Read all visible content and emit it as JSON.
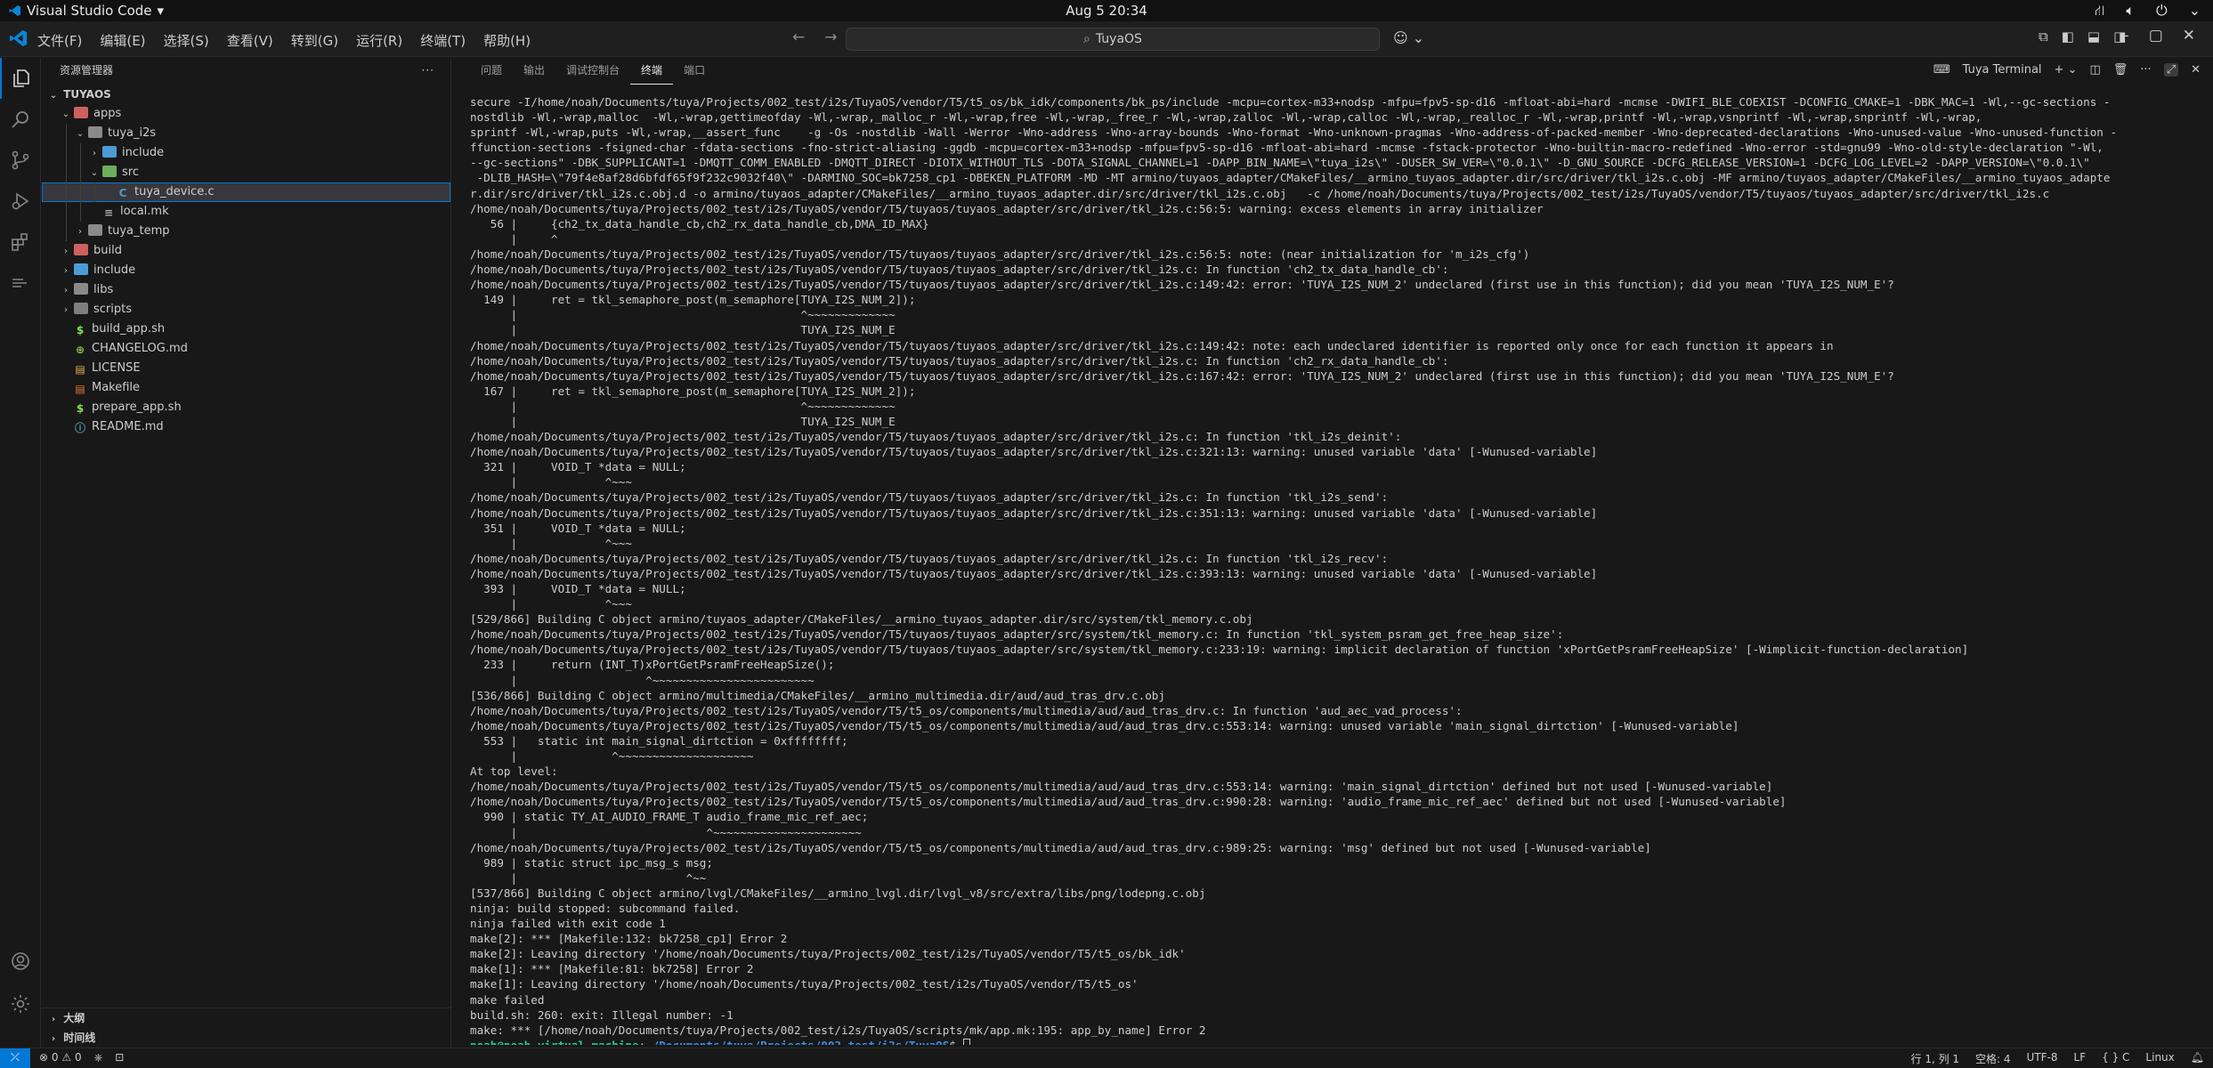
{
  "os": {
    "app_name": "Visual Studio Code",
    "app_menu_arrow": "▾",
    "clock": "Aug 5  20:34"
  },
  "menu": [
    "文件(F)",
    "编辑(E)",
    "选择(S)",
    "查看(V)",
    "转到(G)",
    "运行(R)",
    "终端(T)",
    "帮助(H)"
  ],
  "command_center": {
    "text": "TuyaOS"
  },
  "sidebar": {
    "title": "资源管理器",
    "more": "···",
    "root": "TUYAOS",
    "tree": [
      {
        "label": "apps",
        "depth": 0,
        "chev": "⌄",
        "icon": "folder-red"
      },
      {
        "label": "tuya_i2s",
        "depth": 1,
        "chev": "⌄",
        "icon": "folder"
      },
      {
        "label": "include",
        "depth": 2,
        "chev": "›",
        "icon": "folder-blue"
      },
      {
        "label": "src",
        "depth": 2,
        "chev": "⌄",
        "icon": "folder-green"
      },
      {
        "label": "tuya_device.c",
        "depth": 3,
        "chev": "",
        "icon": "c",
        "selected": true
      },
      {
        "label": "local.mk",
        "depth": 2,
        "chev": "",
        "icon": "mk"
      },
      {
        "label": "tuya_temp",
        "depth": 1,
        "chev": "›",
        "icon": "folder"
      },
      {
        "label": "build",
        "depth": 0,
        "chev": "›",
        "icon": "folder-red"
      },
      {
        "label": "include",
        "depth": 0,
        "chev": "›",
        "icon": "folder-blue"
      },
      {
        "label": "libs",
        "depth": 0,
        "chev": "›",
        "icon": "folder"
      },
      {
        "label": "scripts",
        "depth": 0,
        "chev": "›",
        "icon": "folder-gray"
      },
      {
        "label": "build_app.sh",
        "depth": 0,
        "chev": "",
        "icon": "sh"
      },
      {
        "label": "CHANGELOG.md",
        "depth": 0,
        "chev": "",
        "icon": "changelog"
      },
      {
        "label": "LICENSE",
        "depth": 0,
        "chev": "",
        "icon": "license"
      },
      {
        "label": "Makefile",
        "depth": 0,
        "chev": "",
        "icon": "makefile"
      },
      {
        "label": "prepare_app.sh",
        "depth": 0,
        "chev": "",
        "icon": "sh"
      },
      {
        "label": "README.md",
        "depth": 0,
        "chev": "",
        "icon": "readme"
      }
    ],
    "outline": "大纲",
    "timeline": "时间线"
  },
  "panel": {
    "tabs": [
      "问题",
      "输出",
      "调试控制台",
      "终端",
      "端口"
    ],
    "active_tab": 3,
    "terminal_name": "Tuya Terminal",
    "lines": [
      "secure -I/home/noah/Documents/tuya/Projects/002_test/i2s/TuyaOS/vendor/T5/t5_os/bk_idk/components/bk_ps/include -mcpu=cortex-m33+nodsp -mfpu=fpv5-sp-d16 -mfloat-abi=hard -mcmse -DWIFI_BLE_COEXIST -DCONFIG_CMAKE=1 -DBK_MAC=1 -Wl,--gc-sections -",
      "nostdlib -Wl,-wrap,malloc  -Wl,-wrap,gettimeofday -Wl,-wrap,_malloc_r -Wl,-wrap,free -Wl,-wrap,_free_r -Wl,-wrap,zalloc -Wl,-wrap,calloc -Wl,-wrap,_realloc_r -Wl,-wrap,printf -Wl,-wrap,vsnprintf -Wl,-wrap,snprintf -Wl,-wrap,",
      "sprintf -Wl,-wrap,puts -Wl,-wrap,__assert_func    -g -Os -nostdlib -Wall -Werror -Wno-address -Wno-array-bounds -Wno-format -Wno-unknown-pragmas -Wno-address-of-packed-member -Wno-deprecated-declarations -Wno-unused-value -Wno-unused-function -",
      "ffunction-sections -fsigned-char -fdata-sections -fno-strict-aliasing -ggdb -mcpu=cortex-m33+nodsp -mfpu=fpv5-sp-d16 -mfloat-abi=hard -mcmse -fstack-protector -Wno-builtin-macro-redefined -Wno-error -std=gnu99 -Wno-old-style-declaration \"-Wl,",
      "--gc-sections\" -DBK_SUPPLICANT=1 -DMQTT_COMM_ENABLED -DMQTT_DIRECT -DIOTX_WITHOUT_TLS -DOTA_SIGNAL_CHANNEL=1 -DAPP_BIN_NAME=\\\"tuya_i2s\\\" -DUSER_SW_VER=\\\"0.0.1\\\" -D_GNU_SOURCE -DCFG_RELEASE_VERSION=1 -DCFG_LOG_LEVEL=2 -DAPP_VERSION=\\\"0.0.1\\\"",
      " -DLIB_HASH=\\\"79f4e8af28d6bfdf65f9f232c9032f40\\\" -DARMINO_SOC=bk7258_cp1 -DBEKEN_PLATFORM -MD -MT armino/tuyaos_adapter/CMakeFiles/__armino_tuyaos_adapter.dir/src/driver/tkl_i2s.c.obj -MF armino/tuyaos_adapter/CMakeFiles/__armino_tuyaos_adapte",
      "r.dir/src/driver/tkl_i2s.c.obj.d -o armino/tuyaos_adapter/CMakeFiles/__armino_tuyaos_adapter.dir/src/driver/tkl_i2s.c.obj   -c /home/noah/Documents/tuya/Projects/002_test/i2s/TuyaOS/vendor/T5/tuyaos/tuyaos_adapter/src/driver/tkl_i2s.c",
      "/home/noah/Documents/tuya/Projects/002_test/i2s/TuyaOS/vendor/T5/tuyaos/tuyaos_adapter/src/driver/tkl_i2s.c:56:5: warning: excess elements in array initializer",
      "   56 |     {ch2_tx_data_handle_cb,ch2_rx_data_handle_cb,DMA_ID_MAX}",
      "      |     ^",
      "/home/noah/Documents/tuya/Projects/002_test/i2s/TuyaOS/vendor/T5/tuyaos/tuyaos_adapter/src/driver/tkl_i2s.c:56:5: note: (near initialization for 'm_i2s_cfg')",
      "/home/noah/Documents/tuya/Projects/002_test/i2s/TuyaOS/vendor/T5/tuyaos/tuyaos_adapter/src/driver/tkl_i2s.c: In function 'ch2_tx_data_handle_cb':",
      "/home/noah/Documents/tuya/Projects/002_test/i2s/TuyaOS/vendor/T5/tuyaos/tuyaos_adapter/src/driver/tkl_i2s.c:149:42: error: 'TUYA_I2S_NUM_2' undeclared (first use in this function); did you mean 'TUYA_I2S_NUM_E'?",
      "  149 |     ret = tkl_semaphore_post(m_semaphore[TUYA_I2S_NUM_2]);",
      "      |                                          ^~~~~~~~~~~~~~",
      "      |                                          TUYA_I2S_NUM_E",
      "/home/noah/Documents/tuya/Projects/002_test/i2s/TuyaOS/vendor/T5/tuyaos/tuyaos_adapter/src/driver/tkl_i2s.c:149:42: note: each undeclared identifier is reported only once for each function it appears in",
      "/home/noah/Documents/tuya/Projects/002_test/i2s/TuyaOS/vendor/T5/tuyaos/tuyaos_adapter/src/driver/tkl_i2s.c: In function 'ch2_rx_data_handle_cb':",
      "/home/noah/Documents/tuya/Projects/002_test/i2s/TuyaOS/vendor/T5/tuyaos/tuyaos_adapter/src/driver/tkl_i2s.c:167:42: error: 'TUYA_I2S_NUM_2' undeclared (first use in this function); did you mean 'TUYA_I2S_NUM_E'?",
      "  167 |     ret = tkl_semaphore_post(m_semaphore[TUYA_I2S_NUM_2]);",
      "      |                                          ^~~~~~~~~~~~~~",
      "      |                                          TUYA_I2S_NUM_E",
      "/home/noah/Documents/tuya/Projects/002_test/i2s/TuyaOS/vendor/T5/tuyaos/tuyaos_adapter/src/driver/tkl_i2s.c: In function 'tkl_i2s_deinit':",
      "/home/noah/Documents/tuya/Projects/002_test/i2s/TuyaOS/vendor/T5/tuyaos/tuyaos_adapter/src/driver/tkl_i2s.c:321:13: warning: unused variable 'data' [-Wunused-variable]",
      "  321 |     VOID_T *data = NULL;",
      "      |             ^~~~",
      "/home/noah/Documents/tuya/Projects/002_test/i2s/TuyaOS/vendor/T5/tuyaos/tuyaos_adapter/src/driver/tkl_i2s.c: In function 'tkl_i2s_send':",
      "/home/noah/Documents/tuya/Projects/002_test/i2s/TuyaOS/vendor/T5/tuyaos/tuyaos_adapter/src/driver/tkl_i2s.c:351:13: warning: unused variable 'data' [-Wunused-variable]",
      "  351 |     VOID_T *data = NULL;",
      "      |             ^~~~",
      "/home/noah/Documents/tuya/Projects/002_test/i2s/TuyaOS/vendor/T5/tuyaos/tuyaos_adapter/src/driver/tkl_i2s.c: In function 'tkl_i2s_recv':",
      "/home/noah/Documents/tuya/Projects/002_test/i2s/TuyaOS/vendor/T5/tuyaos/tuyaos_adapter/src/driver/tkl_i2s.c:393:13: warning: unused variable 'data' [-Wunused-variable]",
      "  393 |     VOID_T *data = NULL;",
      "      |             ^~~~",
      "[529/866] Building C object armino/tuyaos_adapter/CMakeFiles/__armino_tuyaos_adapter.dir/src/system/tkl_memory.c.obj",
      "/home/noah/Documents/tuya/Projects/002_test/i2s/TuyaOS/vendor/T5/tuyaos/tuyaos_adapter/src/system/tkl_memory.c: In function 'tkl_system_psram_get_free_heap_size':",
      "/home/noah/Documents/tuya/Projects/002_test/i2s/TuyaOS/vendor/T5/tuyaos/tuyaos_adapter/src/system/tkl_memory.c:233:19: warning: implicit declaration of function 'xPortGetPsramFreeHeapSize' [-Wimplicit-function-declaration]",
      "  233 |     return (INT_T)xPortGetPsramFreeHeapSize();",
      "      |                   ^~~~~~~~~~~~~~~~~~~~~~~~~",
      "[536/866] Building C object armino/multimedia/CMakeFiles/__armino_multimedia.dir/aud/aud_tras_drv.c.obj",
      "/home/noah/Documents/tuya/Projects/002_test/i2s/TuyaOS/vendor/T5/t5_os/components/multimedia/aud/aud_tras_drv.c: In function 'aud_aec_vad_process':",
      "/home/noah/Documents/tuya/Projects/002_test/i2s/TuyaOS/vendor/T5/t5_os/components/multimedia/aud/aud_tras_drv.c:553:14: warning: unused variable 'main_signal_dirtction' [-Wunused-variable]",
      "  553 |   static int main_signal_dirtction = 0xffffffff;",
      "      |              ^~~~~~~~~~~~~~~~~~~~~",
      "At top level:",
      "/home/noah/Documents/tuya/Projects/002_test/i2s/TuyaOS/vendor/T5/t5_os/components/multimedia/aud/aud_tras_drv.c:553:14: warning: 'main_signal_dirtction' defined but not used [-Wunused-variable]",
      "/home/noah/Documents/tuya/Projects/002_test/i2s/TuyaOS/vendor/T5/t5_os/components/multimedia/aud/aud_tras_drv.c:990:28: warning: 'audio_frame_mic_ref_aec' defined but not used [-Wunused-variable]",
      "  990 | static TY_AI_AUDIO_FRAME_T audio_frame_mic_ref_aec;",
      "      |                            ^~~~~~~~~~~~~~~~~~~~~~~",
      "/home/noah/Documents/tuya/Projects/002_test/i2s/TuyaOS/vendor/T5/t5_os/components/multimedia/aud/aud_tras_drv.c:989:25: warning: 'msg' defined but not used [-Wunused-variable]",
      "  989 | static struct ipc_msg_s msg;",
      "      |                         ^~~",
      "[537/866] Building C object armino/lvgl/CMakeFiles/__armino_lvgl.dir/lvgl_v8/src/extra/libs/png/lodepng.c.obj",
      "ninja: build stopped: subcommand failed.",
      "ninja failed with exit code 1",
      "make[2]: *** [Makefile:132: bk7258_cp1] Error 2",
      "make[2]: Leaving directory '/home/noah/Documents/tuya/Projects/002_test/i2s/TuyaOS/vendor/T5/t5_os/bk_idk'",
      "make[1]: *** [Makefile:81: bk7258] Error 2",
      "make[1]: Leaving directory '/home/noah/Documents/tuya/Projects/002_test/i2s/TuyaOS/vendor/T5/t5_os'",
      "make failed",
      "build.sh: 260: exit: Illegal number: -1",
      "make: *** [/home/noah/Documents/tuya/Projects/002_test/i2s/TuyaOS/scripts/mk/app.mk:195: app_by_name] Error 2"
    ],
    "prompt": {
      "user": "noah@noah-virtual-machine",
      "sep": ":",
      "path": "~/Documents/tuya/Projects/002_test/i2s/TuyaOS",
      "symbol": "$ "
    }
  },
  "status": {
    "remote": "⤫",
    "errors": "0",
    "warnings": "0",
    "position": "行 1, 列 1",
    "spaces": "空格: 4",
    "encoding": "UTF-8",
    "eol": "LF",
    "language": "C",
    "platform": "Linux"
  },
  "colors": {
    "accent": "#0078d4",
    "background": "#181818",
    "prompt_user": "#23d18b",
    "prompt_path": "#3b8eea"
  }
}
